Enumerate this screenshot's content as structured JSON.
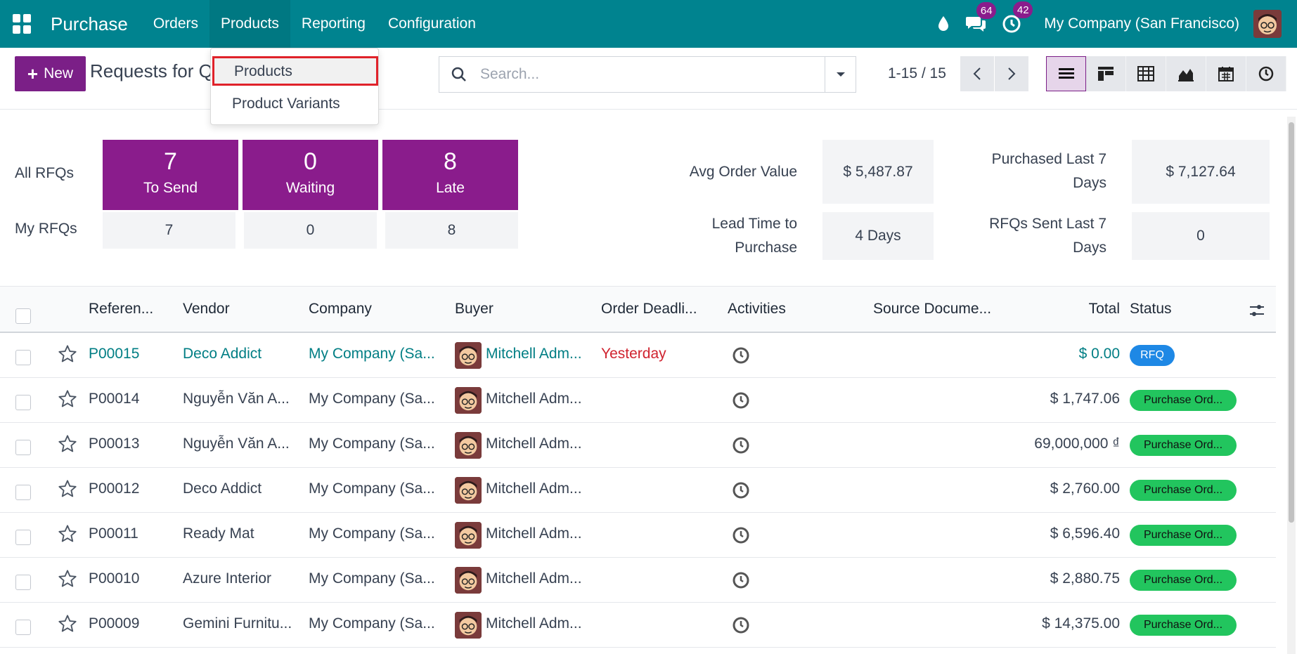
{
  "navbar": {
    "app_name": "Purchase",
    "menu": [
      "Orders",
      "Products",
      "Reporting",
      "Configuration"
    ],
    "messages_count": "64",
    "activities_count": "42",
    "company": "My Company (San Francisco)"
  },
  "control_panel": {
    "new_label": "New",
    "title": "Requests for Q",
    "search_placeholder": "Search...",
    "pager": "1-15 / 15"
  },
  "dropdown": {
    "items": [
      "Products",
      "Product Variants"
    ]
  },
  "dashboard": {
    "all_rfqs_label": "All RFQs",
    "my_rfqs_label": "My RFQs",
    "tiles": [
      {
        "value": "7",
        "label": "To Send"
      },
      {
        "value": "0",
        "label": "Waiting"
      },
      {
        "value": "8",
        "label": "Late"
      }
    ],
    "my_values": [
      "7",
      "0",
      "8"
    ],
    "kpis": {
      "avg_order_label": "Avg Order Value",
      "avg_order_value": "$ 5,487.87",
      "lead_time_label_1": "Lead Time to",
      "lead_time_label_2": "Purchase",
      "lead_time_value": "4 Days",
      "purchased_label_1": "Purchased Last 7",
      "purchased_label_2": "Days",
      "purchased_value": "$ 7,127.64",
      "rfq_sent_label_1": "RFQs Sent Last 7",
      "rfq_sent_label_2": "Days",
      "rfq_sent_value": "0"
    }
  },
  "table": {
    "headers": {
      "reference": "Referen...",
      "vendor": "Vendor",
      "company": "Company",
      "buyer": "Buyer",
      "deadline": "Order Deadli...",
      "activities": "Activities",
      "source": "Source Docume...",
      "total": "Total",
      "status": "Status"
    },
    "rows": [
      {
        "ref": "P00015",
        "vendor": "Deco Addict",
        "company": "My Company (Sa...",
        "buyer": "Mitchell Adm...",
        "deadline": "Yesterday",
        "total": "$ 0.00",
        "status": "RFQ"
      },
      {
        "ref": "P00014",
        "vendor": "Nguyễn Văn A...",
        "company": "My Company (Sa...",
        "buyer": "Mitchell Adm...",
        "deadline": "",
        "total": "$ 1,747.06",
        "status": "Purchase Ord..."
      },
      {
        "ref": "P00013",
        "vendor": "Nguyễn Văn A...",
        "company": "My Company (Sa...",
        "buyer": "Mitchell Adm...",
        "deadline": "",
        "total": "69,000,000 ₫",
        "status": "Purchase Ord..."
      },
      {
        "ref": "P00012",
        "vendor": "Deco Addict",
        "company": "My Company (Sa...",
        "buyer": "Mitchell Adm...",
        "deadline": "",
        "total": "$ 2,760.00",
        "status": "Purchase Ord..."
      },
      {
        "ref": "P00011",
        "vendor": "Ready Mat",
        "company": "My Company (Sa...",
        "buyer": "Mitchell Adm...",
        "deadline": "",
        "total": "$ 6,596.40",
        "status": "Purchase Ord..."
      },
      {
        "ref": "P00010",
        "vendor": "Azure Interior",
        "company": "My Company (Sa...",
        "buyer": "Mitchell Adm...",
        "deadline": "",
        "total": "$ 2,880.75",
        "status": "Purchase Ord..."
      },
      {
        "ref": "P00009",
        "vendor": "Gemini Furnitu...",
        "company": "My Company (Sa...",
        "buyer": "Mitchell Adm...",
        "deadline": "",
        "total": "$ 14,375.00",
        "status": "Purchase Ord..."
      }
    ]
  },
  "colors": {
    "navbar": "#00838f",
    "primary": "#8a1c8c",
    "link": "#017e84",
    "rfq_badge": "#1e88e5",
    "po_badge": "#22c55e",
    "overdue": "#d0232f"
  }
}
